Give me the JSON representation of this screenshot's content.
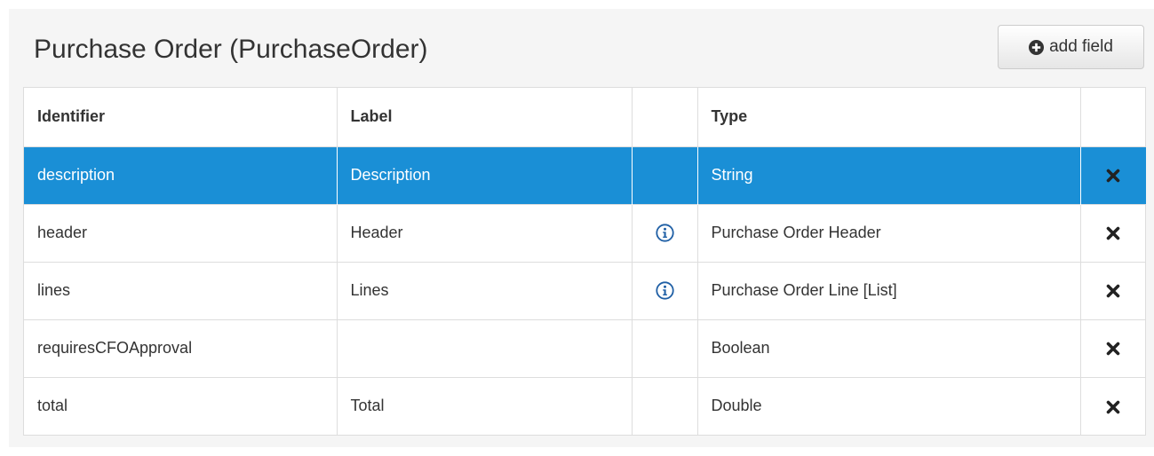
{
  "header": {
    "title": "Purchase Order (PurchaseOrder)",
    "add_button_label": "add field",
    "add_icon": "plus-circle-icon"
  },
  "table": {
    "columns": [
      "Identifier",
      "Label",
      "",
      "Type",
      ""
    ],
    "rows": [
      {
        "identifier": "description",
        "label": "Description",
        "info": false,
        "type": "String",
        "selected": true
      },
      {
        "identifier": "header",
        "label": "Header",
        "info": true,
        "type": "Purchase Order Header",
        "selected": false
      },
      {
        "identifier": "lines",
        "label": "Lines",
        "info": true,
        "type": "Purchase Order Line [List]",
        "selected": false
      },
      {
        "identifier": "requiresCFOApproval",
        "label": "",
        "info": false,
        "type": "Boolean",
        "selected": false
      },
      {
        "identifier": "total",
        "label": "Total",
        "info": false,
        "type": "Double",
        "selected": false
      }
    ],
    "info_icon": "info-circle-icon",
    "delete_icon": "close-icon"
  },
  "colors": {
    "selected_row": "#1a8fd6",
    "info_icon": "#1f5fa5",
    "panel_background": "#f5f5f5"
  }
}
